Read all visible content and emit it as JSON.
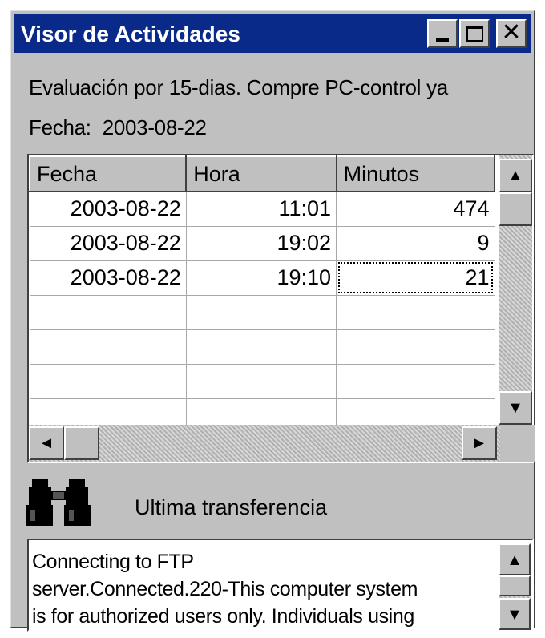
{
  "window": {
    "title": "Visor de Actividades",
    "minimize_icon": "minimize-icon",
    "maximize_icon": "maximize-icon",
    "close_label": "✕"
  },
  "info": {
    "evaluation_text": "Evaluación por 15-dias. Compre PC-control ya",
    "date_label": "Fecha:",
    "date_value": "2003-08-22"
  },
  "table": {
    "columns": [
      "Fecha",
      "Hora",
      "Minutos"
    ],
    "rows": [
      [
        "2003-08-22",
        "11:01",
        "474"
      ],
      [
        "2003-08-22",
        "19:02",
        "9"
      ],
      [
        "2003-08-22",
        "19:10",
        "21"
      ]
    ],
    "empty_rows": 4
  },
  "scroll_glyphs": {
    "up": "▲",
    "down": "▼",
    "left": "◄",
    "right": "►"
  },
  "transfer": {
    "icon": "binoculars-icon",
    "label": "Ultima transferencia"
  },
  "log": {
    "text": "Connecting to FTP\nserver.Connected.220-This computer system\nis for authorized users only. Individuals using"
  },
  "colors": {
    "titlebar": "#0a2a8a",
    "window_bg": "#c0c0c0"
  }
}
